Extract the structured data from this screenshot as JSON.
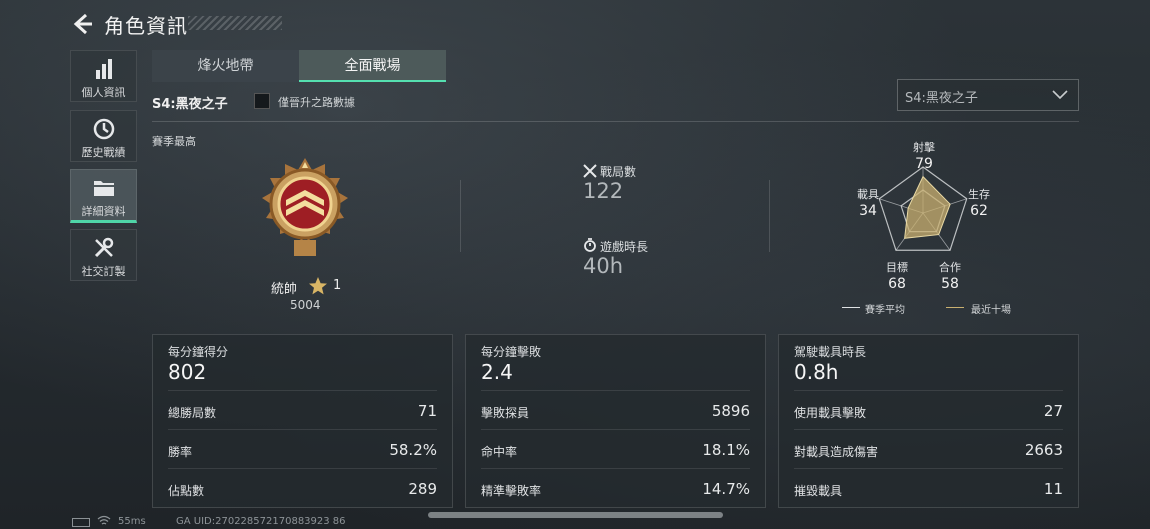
{
  "header": {
    "title": "角色資訊"
  },
  "nav": [
    {
      "label": "個人資訊",
      "icon": "bar-chart-icon"
    },
    {
      "label": "歷史戰績",
      "icon": "history-clock-icon"
    },
    {
      "label": "詳細資料",
      "icon": "folder-icon",
      "active": true
    },
    {
      "label": "社交訂製",
      "icon": "tools-icon"
    }
  ],
  "tabs": [
    "烽火地帶",
    "全面戰場"
  ],
  "filter": {
    "season_label": "S4:黑夜之子",
    "checkbox_label": "僅晉升之路數據",
    "dropdown_value": "S4:黑夜之子"
  },
  "season_best": "賽季最高",
  "rank": {
    "name": "統帥",
    "level": "1",
    "points": "5004"
  },
  "stats": {
    "matches_label": "戰局數",
    "matches_value": "122",
    "time_label": "遊戲時長",
    "time_value": "40h"
  },
  "radar": {
    "axes": [
      {
        "label": "射擊",
        "value": "79"
      },
      {
        "label": "生存",
        "value": "62"
      },
      {
        "label": "合作",
        "value": "58"
      },
      {
        "label": "目標",
        "value": "68"
      },
      {
        "label": "載具",
        "value": "34"
      }
    ],
    "legend_avg": "賽季平均",
    "legend_recent": "最近十場",
    "colors": {
      "recent": "#c9b070",
      "grid": "#e0e2e4"
    }
  },
  "cards": [
    {
      "title": "每分鐘得分",
      "value": "802",
      "rows": [
        {
          "label": "總勝局數",
          "value": "71"
        },
        {
          "label": "勝率",
          "value": "58.2%"
        },
        {
          "label": "佔點數",
          "value": "289"
        }
      ]
    },
    {
      "title": "每分鐘擊敗",
      "value": "2.4",
      "rows": [
        {
          "label": "擊敗探員",
          "value": "5896"
        },
        {
          "label": "命中率",
          "value": "18.1%"
        },
        {
          "label": "精準擊敗率",
          "value": "14.7%"
        }
      ]
    },
    {
      "title": "駕駛載具時長",
      "value": "0.8h",
      "rows": [
        {
          "label": "使用載具擊敗",
          "value": "27"
        },
        {
          "label": "對載具造成傷害",
          "value": "2663"
        },
        {
          "label": "摧毀載具",
          "value": "11"
        }
      ]
    }
  ],
  "footer": {
    "ping": "55ms",
    "uid": "GA UID:270228572170883923 86"
  }
}
